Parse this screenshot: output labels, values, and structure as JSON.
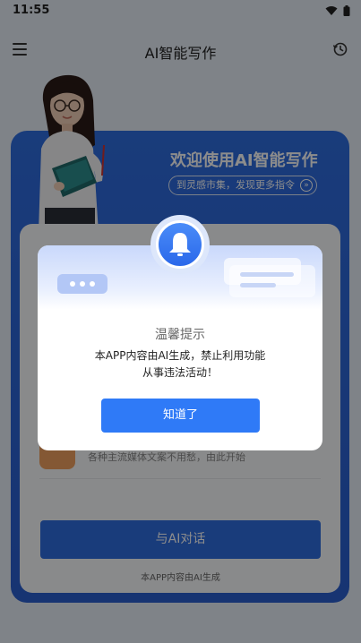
{
  "status_bar": {
    "time": "11:55"
  },
  "app_bar": {
    "title": "AI智能写作"
  },
  "hero": {
    "title": "欢迎使用AI智能写作",
    "subtitle": "到灵感市集，发现更多指令"
  },
  "panel": {
    "feature_desc": "各种主流媒体文案不用愁，由此开始",
    "chat_button": "与AI对话",
    "footer": "本APP内容由AI生成"
  },
  "dialog": {
    "title": "温馨提示",
    "message_line1": "本APP内容由AI生成，禁止利用功能",
    "message_line2": "从事违法活动！",
    "confirm_button": "知道了"
  },
  "colors": {
    "primary": "#2f6de0",
    "dialog_button": "#2f7af7",
    "background": "#e8eef7"
  }
}
